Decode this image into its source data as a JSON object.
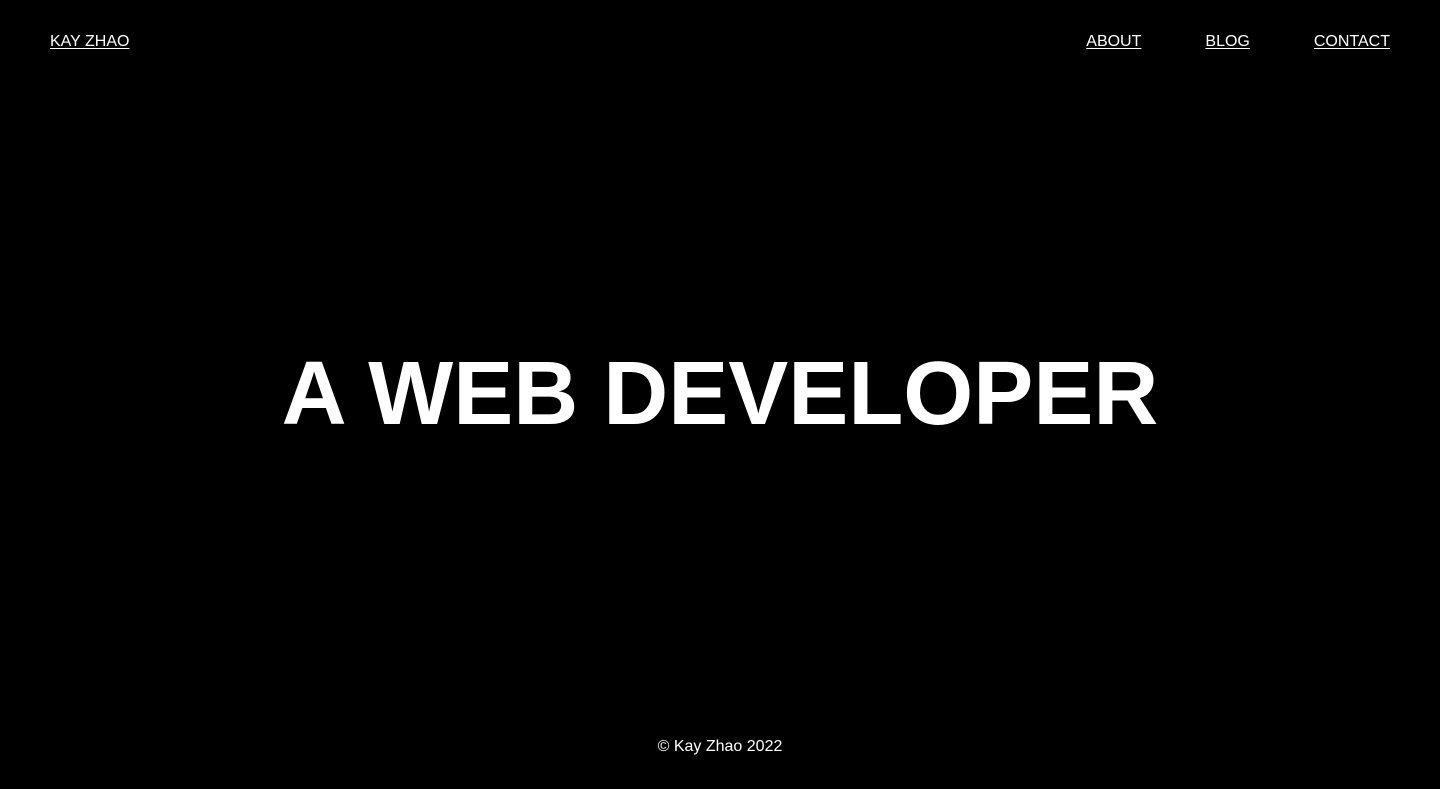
{
  "header": {
    "logo_label": "KAY ZHAO",
    "nav": [
      {
        "label": "ABOUT"
      },
      {
        "label": "BLOG"
      },
      {
        "label": "CONTACT"
      }
    ]
  },
  "hero": {
    "headline": "A WEB DEVELOPER"
  },
  "footer": {
    "copyright": "© Kay Zhao 2022"
  },
  "colors": {
    "background": "#000000",
    "text": "#ffffff"
  }
}
